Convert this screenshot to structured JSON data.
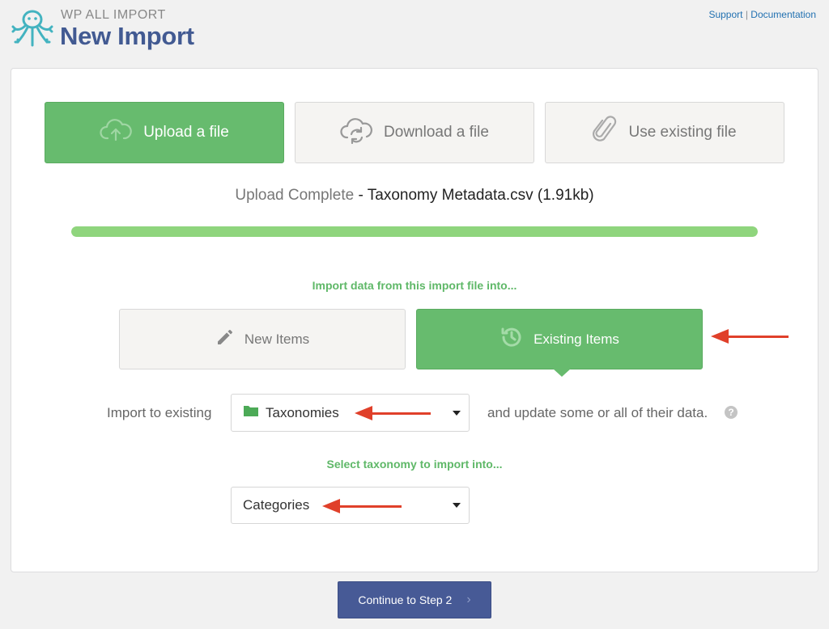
{
  "header": {
    "brand_sub": "WP ALL IMPORT",
    "title": "New Import",
    "support_link": "Support",
    "separator": "|",
    "documentation_link": "Documentation"
  },
  "source_buttons": [
    {
      "label": "Upload a file",
      "icon": "cloud-upload-icon",
      "active": true
    },
    {
      "label": "Download a file",
      "icon": "cloud-sync-icon",
      "active": false
    },
    {
      "label": "Use existing file",
      "icon": "paperclip-icon",
      "active": false
    }
  ],
  "upload_status": {
    "prefix": "Upload Complete",
    "separator": " - ",
    "file": "Taxonomy Metadata.csv (1.91kb)",
    "progress_percent": 100
  },
  "import_mode": {
    "heading": "Import data from this import file into...",
    "new_items_label": "New Items",
    "existing_items_label": "Existing Items",
    "selected": "Existing Items"
  },
  "existing_row": {
    "prefix": "Import to existing",
    "selected_type": "Taxonomies",
    "suffix": "and update some or all of their data.",
    "help": "?"
  },
  "taxonomy_select": {
    "heading": "Select taxonomy to import into...",
    "selected": "Categories"
  },
  "continue_button": {
    "label": "Continue to Step 2",
    "chevron": "›"
  },
  "colors": {
    "green": "#67bb6e",
    "progress": "#8fd57d",
    "brand_blue": "#425a92",
    "button_blue": "#475a96",
    "arrow_red": "#e0402a"
  }
}
